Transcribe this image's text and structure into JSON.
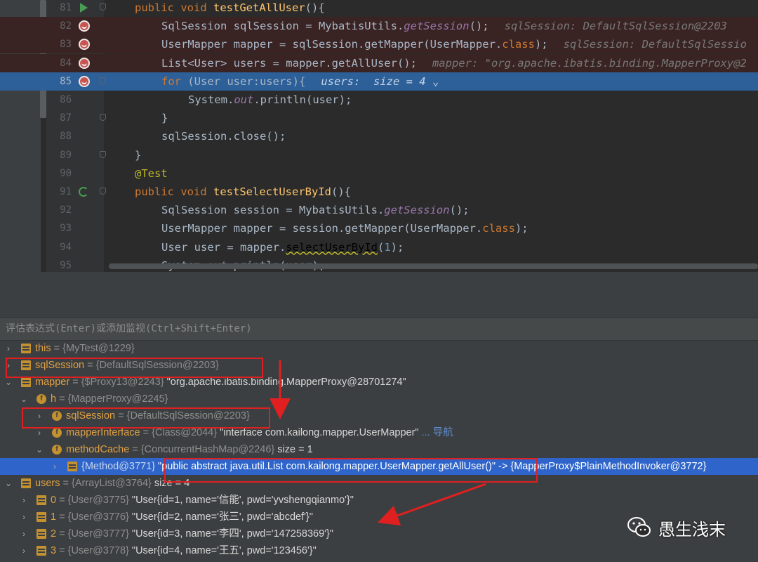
{
  "editor": {
    "lines": [
      {
        "n": "81",
        "gutter": "run",
        "indent": 1,
        "tokens": [
          [
            "kw",
            "public "
          ],
          [
            "kw",
            "void "
          ],
          [
            "fn",
            "testGetAllUser"
          ],
          [
            "pl",
            "(){"
          ]
        ],
        "hint": ""
      },
      {
        "n": "82",
        "gutter": "bp",
        "indent": 2,
        "tokens": [
          [
            "pl",
            "SqlSession sqlSession = MybatisUtils."
          ],
          [
            "it",
            "getSession"
          ],
          [
            "pl",
            "();"
          ]
        ],
        "hint": "sqlSession: DefaultSqlSession@2203"
      },
      {
        "n": "83",
        "gutter": "bp",
        "indent": 2,
        "tokens": [
          [
            "pl",
            "UserMapper mapper = sqlSession.getMapper(UserMapper."
          ],
          [
            "kw",
            "class"
          ],
          [
            "pl",
            ");"
          ]
        ],
        "hint": "sqlSession: DefaultSqlSessio"
      },
      {
        "n": "84",
        "gutter": "bp",
        "indent": 2,
        "tokens": [
          [
            "pl",
            "List<User> users = mapper.getAllUser();"
          ]
        ],
        "hint": "mapper: \"org.apache.ibatis.binding.MapperProxy@2"
      },
      {
        "n": "85",
        "gutter": "bp",
        "indent": 2,
        "exec": true,
        "tokens": [
          [
            "kw",
            "for "
          ],
          [
            "pl",
            "(User user:users){"
          ]
        ],
        "hint": "users:  size = 4 ⌄"
      },
      {
        "n": "86",
        "gutter": "",
        "indent": 3,
        "tokens": [
          [
            "pl",
            "System."
          ],
          [
            "it",
            "out"
          ],
          [
            "pl",
            ".println(user);"
          ]
        ],
        "hint": ""
      },
      {
        "n": "87",
        "gutter": "",
        "indent": 2,
        "tokens": [
          [
            "pl",
            "}"
          ]
        ],
        "hint": ""
      },
      {
        "n": "88",
        "gutter": "",
        "indent": 2,
        "tokens": [
          [
            "pl",
            "sqlSession.close();"
          ]
        ],
        "hint": ""
      },
      {
        "n": "89",
        "gutter": "",
        "indent": 1,
        "tokens": [
          [
            "pl",
            "}"
          ]
        ],
        "hint": ""
      },
      {
        "n": "90",
        "gutter": "",
        "indent": 1,
        "tokens": [
          [
            "ann",
            "@Test"
          ]
        ],
        "hint": ""
      },
      {
        "n": "91",
        "gutter": "spin",
        "indent": 1,
        "tokens": [
          [
            "kw",
            "public "
          ],
          [
            "kw",
            "void "
          ],
          [
            "fn",
            "testSelectUserById"
          ],
          [
            "pl",
            "(){"
          ]
        ],
        "hint": ""
      },
      {
        "n": "92",
        "gutter": "",
        "indent": 2,
        "tokens": [
          [
            "pl",
            "SqlSession session = MybatisUtils."
          ],
          [
            "it",
            "getSession"
          ],
          [
            "pl",
            "();"
          ]
        ],
        "hint": ""
      },
      {
        "n": "93",
        "gutter": "",
        "indent": 2,
        "tokens": [
          [
            "pl",
            "UserMapper mapper = session.getMapper(UserMapper."
          ],
          [
            "kw",
            "class"
          ],
          [
            "pl",
            ");"
          ]
        ],
        "hint": ""
      },
      {
        "n": "94",
        "gutter": "",
        "indent": 2,
        "tokens": [
          [
            "pl",
            "User user = mapper."
          ],
          [
            "warn",
            "selectUserById"
          ],
          [
            "pl",
            "("
          ],
          [
            "num",
            "1"
          ],
          [
            "pl",
            ");"
          ]
        ],
        "hint": ""
      },
      {
        "n": "95",
        "gutter": "",
        "indent": 2,
        "tokens": [
          [
            "pl",
            "System."
          ],
          [
            "it",
            "out"
          ],
          [
            "pl",
            ".println(user);"
          ]
        ],
        "hint": ""
      }
    ]
  },
  "debugger": {
    "eval_placeholder": "评估表达式(Enter)或添加监视(Ctrl+Shift+Enter)",
    "toolbar_icons": [
      "table-icon",
      "layout-icon"
    ],
    "variables": [
      {
        "depth": 0,
        "arrow": "›",
        "icon": "field",
        "name": "this",
        "ref": "{MyTest@1229}",
        "value": "",
        "nav": ""
      },
      {
        "depth": 0,
        "arrow": "›",
        "icon": "field",
        "name": "sqlSession",
        "ref": "{DefaultSqlSession@2203}",
        "value": "",
        "nav": ""
      },
      {
        "depth": 0,
        "arrow": "⌄",
        "icon": "field",
        "name": "mapper",
        "ref": "{$Proxy13@2243}",
        "value": "\"org.apache.ibatis.binding.MapperProxy@28701274\"",
        "nav": ""
      },
      {
        "depth": 1,
        "arrow": "⌄",
        "icon": "f",
        "name": "h",
        "ref": "{MapperProxy@2245}",
        "value": "",
        "nav": ""
      },
      {
        "depth": 2,
        "arrow": "›",
        "icon": "f",
        "name": "sqlSession",
        "ref": "{DefaultSqlSession@2203}",
        "value": "",
        "nav": ""
      },
      {
        "depth": 2,
        "arrow": "›",
        "icon": "f",
        "name": "mapperInterface",
        "ref": "{Class@2044}",
        "value": "\"interface com.kailong.mapper.UserMapper\"",
        "nav": "... 导航"
      },
      {
        "depth": 2,
        "arrow": "⌄",
        "icon": "f",
        "name": "methodCache",
        "ref": "{ConcurrentHashMap@2246}",
        "value": " size = 1",
        "nav": ""
      },
      {
        "depth": 3,
        "arrow": "›",
        "icon": "field",
        "name": "",
        "ref": "{Method@3771}",
        "value": "\"public abstract java.util.List com.kailong.mapper.UserMapper.getAllUser()\" -> {MapperProxy$PlainMethodInvoker@3772}",
        "nav": "",
        "selected": true
      },
      {
        "depth": 0,
        "arrow": "⌄",
        "icon": "field",
        "name": "users",
        "ref": "{ArrayList@3764}",
        "value": " size = 4",
        "nav": ""
      },
      {
        "depth": 1,
        "arrow": "›",
        "icon": "field",
        "name": "0",
        "ref": "{User@3775}",
        "value": "\"User{id=1, name='信能', pwd='yvshengqianmo'}\"",
        "nav": ""
      },
      {
        "depth": 1,
        "arrow": "›",
        "icon": "field",
        "name": "1",
        "ref": "{User@3776}",
        "value": "\"User{id=2, name='张三', pwd='abcdef'}\"",
        "nav": ""
      },
      {
        "depth": 1,
        "arrow": "›",
        "icon": "field",
        "name": "2",
        "ref": "{User@3777}",
        "value": "\"User{id=3, name='李四', pwd='147258369'}\"",
        "nav": ""
      },
      {
        "depth": 1,
        "arrow": "›",
        "icon": "field",
        "name": "3",
        "ref": "{User@3778}",
        "value": "\"User{id=4, name='王五', pwd='123456'}\"",
        "nav": ""
      }
    ]
  },
  "annotations": {
    "highlight_color": "#e02020"
  },
  "watermark": {
    "text": "愚生浅末",
    "icon": "wechat-icon"
  }
}
